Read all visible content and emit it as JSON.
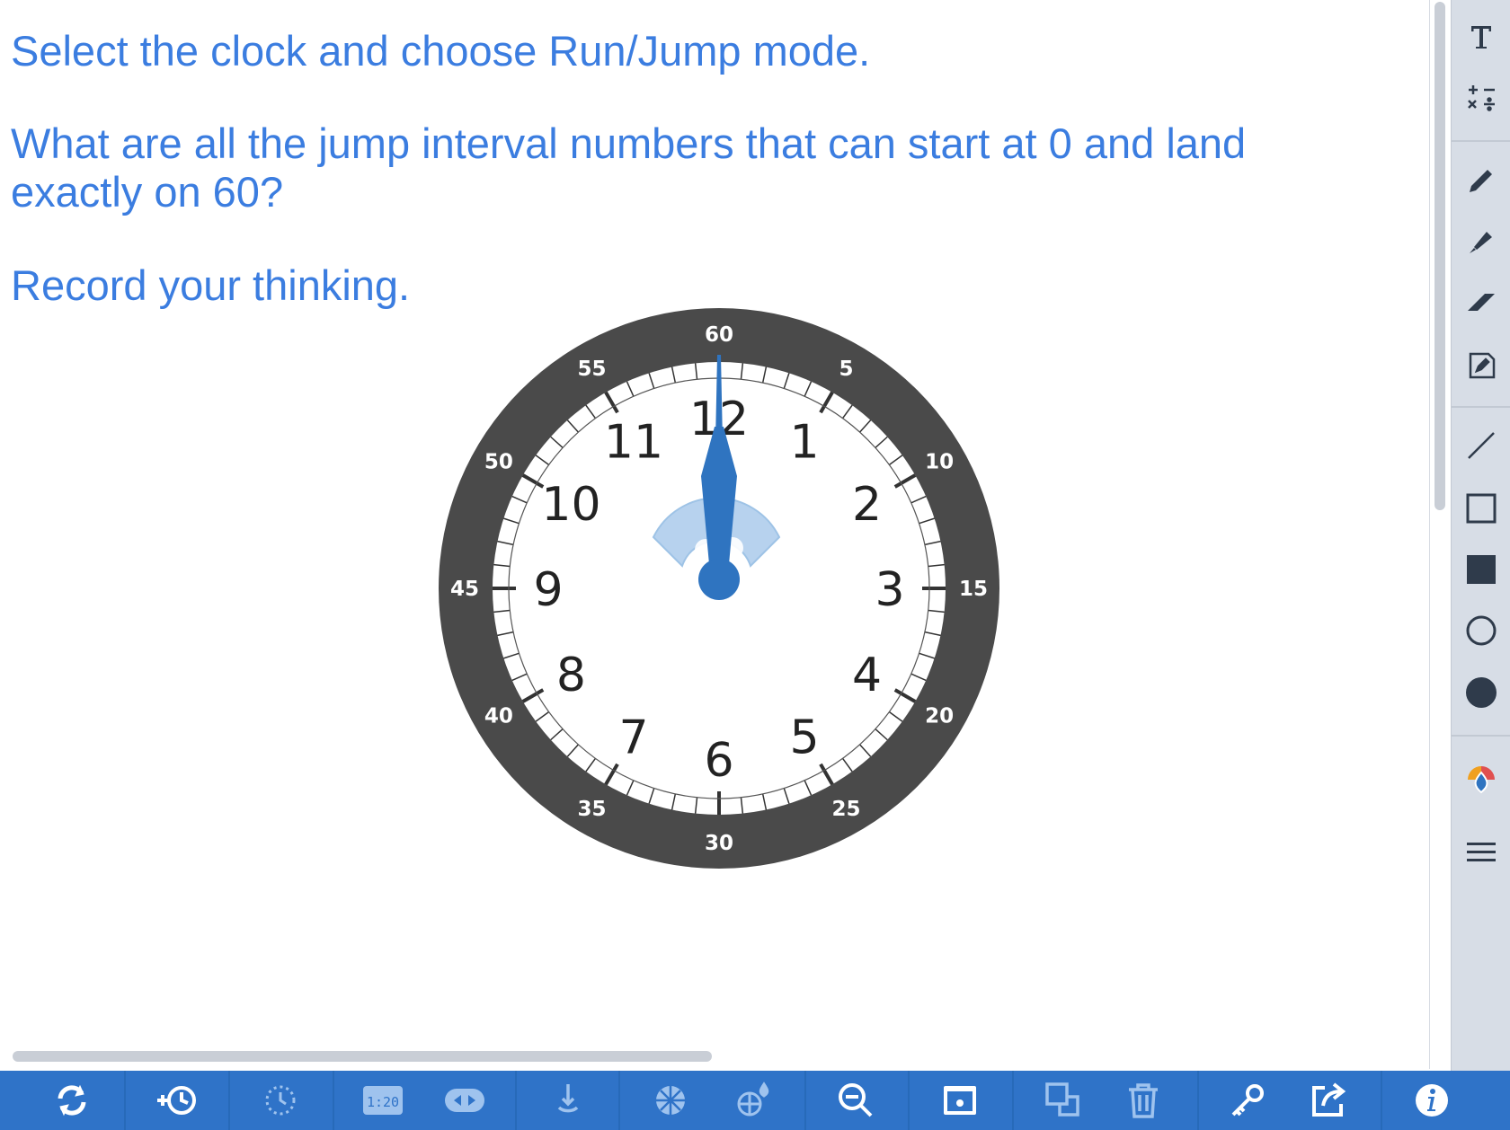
{
  "prompt": {
    "line1": "Select the clock and choose Run/Jump mode.",
    "line2a": "What are all the jump interval numbers that can start at 0 and land",
    "line2b": "exactly on 60?",
    "line3": "Record your thinking."
  },
  "clock": {
    "hour_numbers": [
      "12",
      "1",
      "2",
      "3",
      "4",
      "5",
      "6",
      "7",
      "8",
      "9",
      "10",
      "11"
    ],
    "minute_labels": [
      "60",
      "5",
      "10",
      "15",
      "20",
      "25",
      "30",
      "35",
      "40",
      "45",
      "50",
      "55"
    ],
    "minute_hand_position": 0,
    "colors": {
      "bezel": "#4a4a4a",
      "face": "#ffffff",
      "hand": "#2f74c0",
      "hour_numbers": "#222222",
      "minute_labels": "#ffffff",
      "gear": "#a8c8e8"
    }
  },
  "sidebar": {
    "icons": [
      "text-tool-icon",
      "equation-tool-icon",
      "pencil-icon",
      "highlighter-icon",
      "eraser-icon",
      "note-icon",
      "line-icon",
      "rectangle-icon",
      "filled-rectangle-icon",
      "circle-icon",
      "filled-circle-icon",
      "color-picker-icon",
      "line-width-icon"
    ]
  },
  "toolbar": {
    "icons": [
      "reset-icon",
      "add-clock-icon",
      "clock-face-icon",
      "digital-time-icon",
      "run-jump-icon",
      "drag-hand-icon",
      "fraction-wheel-icon",
      "color-fill-icon",
      "zoom-out-icon",
      "card-icon",
      "duplicate-icon",
      "trash-icon",
      "key-icon",
      "share-icon",
      "info-icon"
    ]
  },
  "colors": {
    "prompt_text": "#3b7de0",
    "toolbar": "#2f73c8",
    "sidebar": "#d7dde6",
    "sidebar_icons": "#2f3b4b"
  }
}
